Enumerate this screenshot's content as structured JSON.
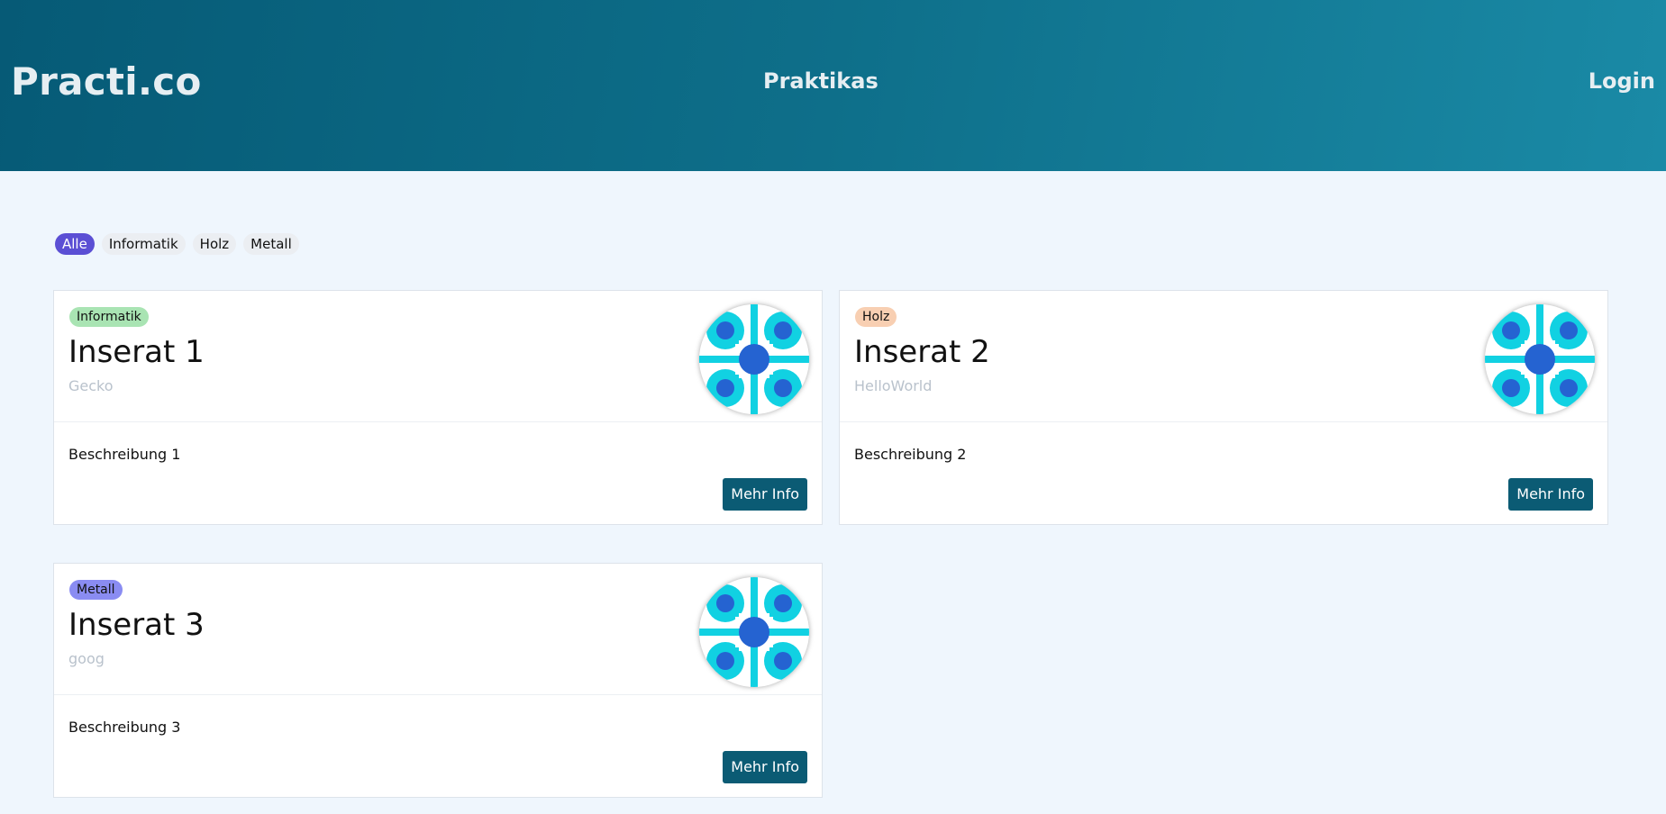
{
  "header": {
    "logo": "Practi.co",
    "nav_praktikas": "Praktikas",
    "nav_login": "Login"
  },
  "filters": [
    {
      "label": "Alle",
      "active": true
    },
    {
      "label": "Informatik",
      "active": false
    },
    {
      "label": "Holz",
      "active": false
    },
    {
      "label": "Metall",
      "active": false
    }
  ],
  "cards": [
    {
      "tag": "Informatik",
      "tag_color": "#a9e4b3",
      "title": "Inserat 1",
      "company": "Gecko",
      "description": "Beschreibung 1",
      "button": "Mehr Info",
      "image_icon": "company-logo-icon"
    },
    {
      "tag": "Holz",
      "tag_color": "#f8cfb2",
      "title": "Inserat 2",
      "company": "HelloWorld",
      "description": "Beschreibung 2",
      "button": "Mehr Info",
      "image_icon": "company-logo-icon"
    },
    {
      "tag": "Metall",
      "tag_color": "#8a8cf2",
      "title": "Inserat 3",
      "company": "goog",
      "description": "Beschreibung 3",
      "button": "Mehr Info",
      "image_icon": "company-logo-icon"
    }
  ],
  "colors": {
    "header_start": "#065a76",
    "header_end": "#1a8aa6",
    "accent_button": "#0b5b74",
    "filter_active": "#5b4fd4",
    "logo_cyan": "#11d1e2",
    "logo_blue": "#2563d1"
  }
}
